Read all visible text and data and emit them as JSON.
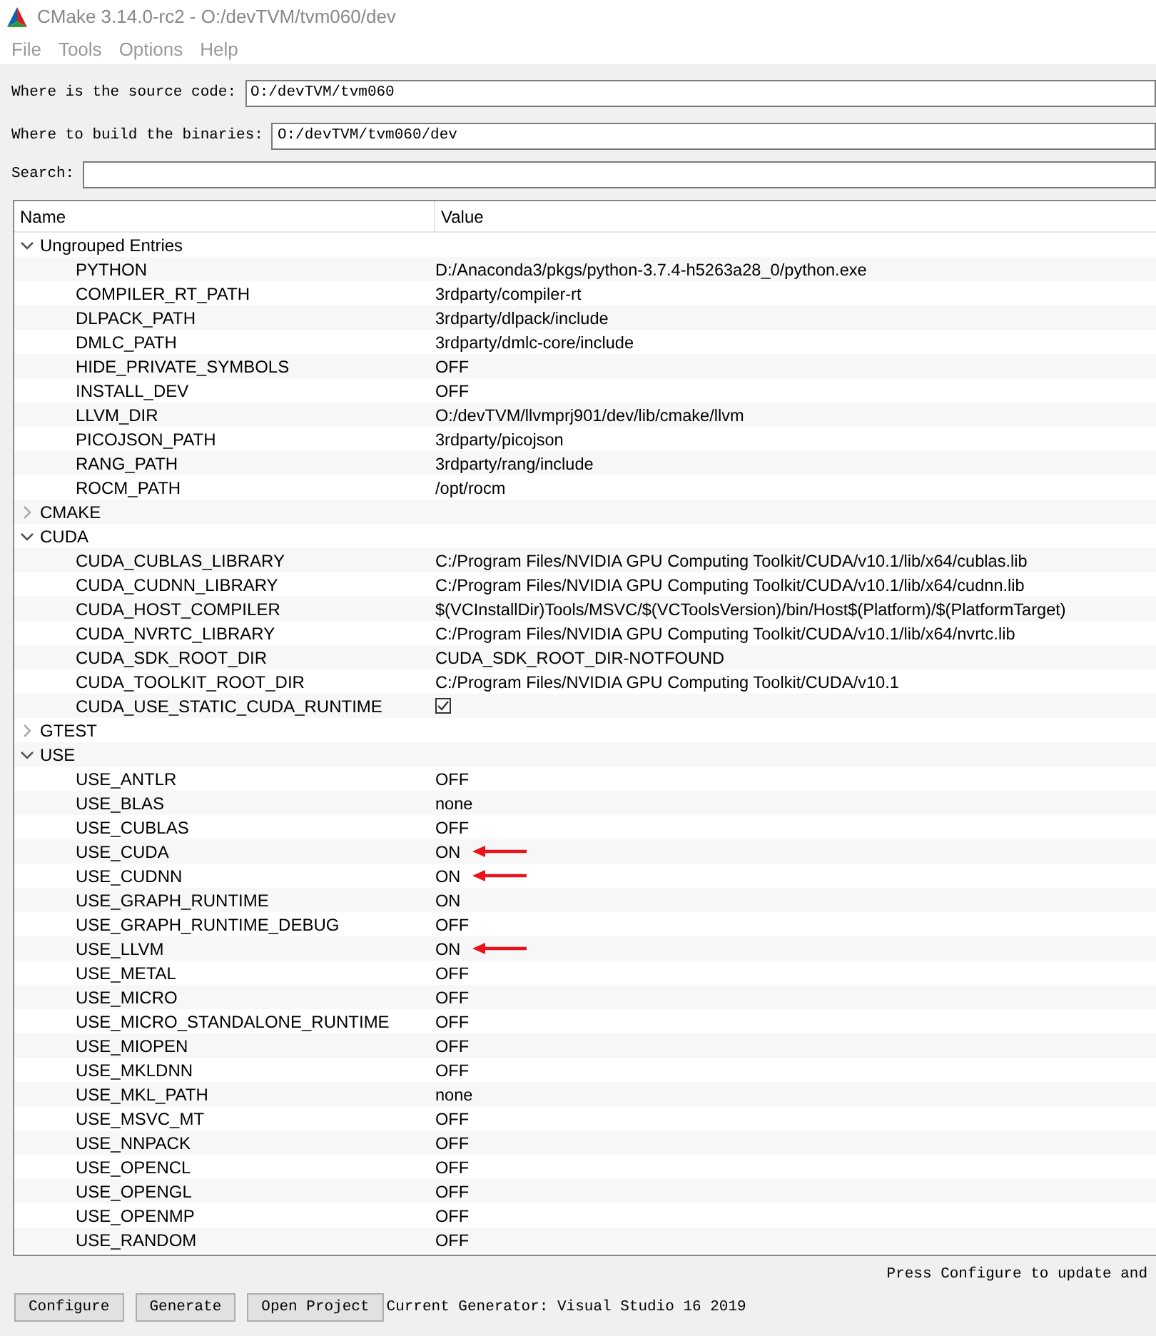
{
  "window": {
    "title": "CMake 3.14.0-rc2 - O:/devTVM/tvm060/dev"
  },
  "menu": [
    "File",
    "Tools",
    "Options",
    "Help"
  ],
  "source": {
    "label": "Where is the source code:",
    "value": "O:/devTVM/tvm060"
  },
  "build": {
    "label": "Where to build the binaries:",
    "value": "O:/devTVM/tvm060/dev"
  },
  "search": {
    "label": "Search:"
  },
  "table": {
    "columns": [
      "Name",
      "Value"
    ],
    "groups": [
      {
        "name": "Ungrouped Entries",
        "expanded": true,
        "children": [
          {
            "name": "PYTHON",
            "kind": "text",
            "value": "D:/Anaconda3/pkgs/python-3.7.4-h5263a28_0/python.exe",
            "marked": false
          },
          {
            "name": "COMPILER_RT_PATH",
            "kind": "text",
            "value": "3rdparty/compiler-rt",
            "marked": false
          },
          {
            "name": "DLPACK_PATH",
            "kind": "text",
            "value": "3rdparty/dlpack/include",
            "marked": false
          },
          {
            "name": "DMLC_PATH",
            "kind": "text",
            "value": "3rdparty/dmlc-core/include",
            "marked": false
          },
          {
            "name": "HIDE_PRIVATE_SYMBOLS",
            "kind": "text",
            "value": "OFF",
            "marked": false
          },
          {
            "name": "INSTALL_DEV",
            "kind": "text",
            "value": "OFF",
            "marked": false
          },
          {
            "name": "LLVM_DIR",
            "kind": "text",
            "value": "O:/devTVM/llvmprj901/dev/lib/cmake/llvm",
            "marked": false
          },
          {
            "name": "PICOJSON_PATH",
            "kind": "text",
            "value": "3rdparty/picojson",
            "marked": false
          },
          {
            "name": "RANG_PATH",
            "kind": "text",
            "value": "3rdparty/rang/include",
            "marked": false
          },
          {
            "name": "ROCM_PATH",
            "kind": "text",
            "value": "/opt/rocm",
            "marked": false
          }
        ]
      },
      {
        "name": "CMAKE",
        "expanded": false
      },
      {
        "name": "CUDA",
        "expanded": true,
        "children": [
          {
            "name": "CUDA_CUBLAS_LIBRARY",
            "kind": "text",
            "value": "C:/Program Files/NVIDIA GPU Computing Toolkit/CUDA/v10.1/lib/x64/cublas.lib",
            "marked": false
          },
          {
            "name": "CUDA_CUDNN_LIBRARY",
            "kind": "text",
            "value": "C:/Program Files/NVIDIA GPU Computing Toolkit/CUDA/v10.1/lib/x64/cudnn.lib",
            "marked": false
          },
          {
            "name": "CUDA_HOST_COMPILER",
            "kind": "text",
            "value": "$(VCInstallDir)Tools/MSVC/$(VCToolsVersion)/bin/Host$(Platform)/$(PlatformTarget)",
            "marked": false
          },
          {
            "name": "CUDA_NVRTC_LIBRARY",
            "kind": "text",
            "value": "C:/Program Files/NVIDIA GPU Computing Toolkit/CUDA/v10.1/lib/x64/nvrtc.lib",
            "marked": false
          },
          {
            "name": "CUDA_SDK_ROOT_DIR",
            "kind": "text",
            "value": "CUDA_SDK_ROOT_DIR-NOTFOUND",
            "marked": false
          },
          {
            "name": "CUDA_TOOLKIT_ROOT_DIR",
            "kind": "text",
            "value": "C:/Program Files/NVIDIA GPU Computing Toolkit/CUDA/v10.1",
            "marked": false
          },
          {
            "name": "CUDA_USE_STATIC_CUDA_RUNTIME",
            "kind": "checkbox",
            "checked": true,
            "marked": false
          }
        ]
      },
      {
        "name": "GTEST",
        "expanded": false
      },
      {
        "name": "USE",
        "expanded": true,
        "children": [
          {
            "name": "USE_ANTLR",
            "kind": "text",
            "value": "OFF",
            "marked": false
          },
          {
            "name": "USE_BLAS",
            "kind": "text",
            "value": "none",
            "marked": false
          },
          {
            "name": "USE_CUBLAS",
            "kind": "text",
            "value": "OFF",
            "marked": false
          },
          {
            "name": "USE_CUDA",
            "kind": "text",
            "value": "ON",
            "marked": true
          },
          {
            "name": "USE_CUDNN",
            "kind": "text",
            "value": "ON",
            "marked": true
          },
          {
            "name": "USE_GRAPH_RUNTIME",
            "kind": "text",
            "value": "ON",
            "marked": false
          },
          {
            "name": "USE_GRAPH_RUNTIME_DEBUG",
            "kind": "text",
            "value": "OFF",
            "marked": false
          },
          {
            "name": "USE_LLVM",
            "kind": "text",
            "value": "ON",
            "marked": true
          },
          {
            "name": "USE_METAL",
            "kind": "text",
            "value": "OFF",
            "marked": false
          },
          {
            "name": "USE_MICRO",
            "kind": "text",
            "value": "OFF",
            "marked": false
          },
          {
            "name": "USE_MICRO_STANDALONE_RUNTIME",
            "kind": "text",
            "value": "OFF",
            "marked": false
          },
          {
            "name": "USE_MIOPEN",
            "kind": "text",
            "value": "OFF",
            "marked": false
          },
          {
            "name": "USE_MKLDNN",
            "kind": "text",
            "value": "OFF",
            "marked": false
          },
          {
            "name": "USE_MKL_PATH",
            "kind": "text",
            "value": "none",
            "marked": false
          },
          {
            "name": "USE_MSVC_MT",
            "kind": "text",
            "value": "OFF",
            "marked": false
          },
          {
            "name": "USE_NNPACK",
            "kind": "text",
            "value": "OFF",
            "marked": false
          },
          {
            "name": "USE_OPENCL",
            "kind": "text",
            "value": "OFF",
            "marked": false
          },
          {
            "name": "USE_OPENGL",
            "kind": "text",
            "value": "OFF",
            "marked": false
          },
          {
            "name": "USE_OPENMP",
            "kind": "text",
            "value": "OFF",
            "marked": false
          },
          {
            "name": "USE_RANDOM",
            "kind": "text",
            "value": "OFF",
            "marked": false
          }
        ]
      }
    ]
  },
  "status": "Press Configure to update and",
  "buttons": [
    "Configure",
    "Generate",
    "Open Project"
  ],
  "generator": "Current Generator: Visual Studio 16 2019"
}
